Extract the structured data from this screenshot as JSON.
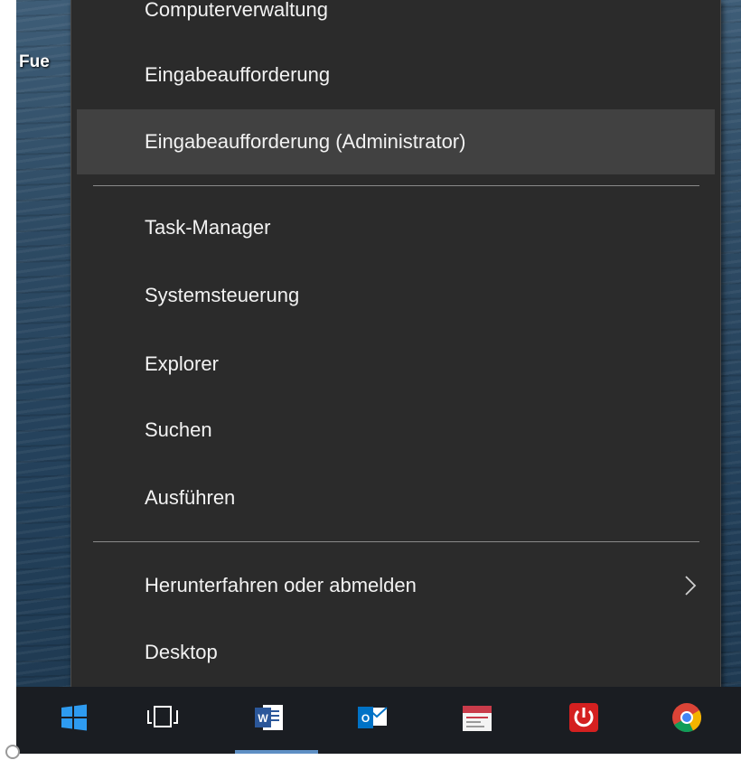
{
  "desktop": {
    "label": "Fue"
  },
  "menu": {
    "items": [
      {
        "label": "Computerverwaltung"
      },
      {
        "label": "Eingabeaufforderung"
      },
      {
        "label": "Eingabeaufforderung (Administrator)",
        "highlighted": true
      },
      {
        "label": "Task-Manager"
      },
      {
        "label": "Systemsteuerung"
      },
      {
        "label": "Explorer"
      },
      {
        "label": "Suchen"
      },
      {
        "label": "Ausführen"
      },
      {
        "label": "Herunterfahren oder abmelden",
        "has_submenu": true
      },
      {
        "label": "Desktop"
      }
    ]
  },
  "taskbar": {
    "icons": [
      {
        "name": "windows-start-icon"
      },
      {
        "name": "task-view-icon"
      },
      {
        "name": "word-icon"
      },
      {
        "name": "outlook-icon"
      },
      {
        "name": "calendar-app-icon"
      },
      {
        "name": "power-app-icon"
      },
      {
        "name": "chrome-icon"
      }
    ]
  },
  "colors": {
    "menu_background": "#2b2b2b",
    "menu_highlight": "#414141",
    "menu_text": "#f2f2f2",
    "taskbar": "#1a1d22"
  }
}
